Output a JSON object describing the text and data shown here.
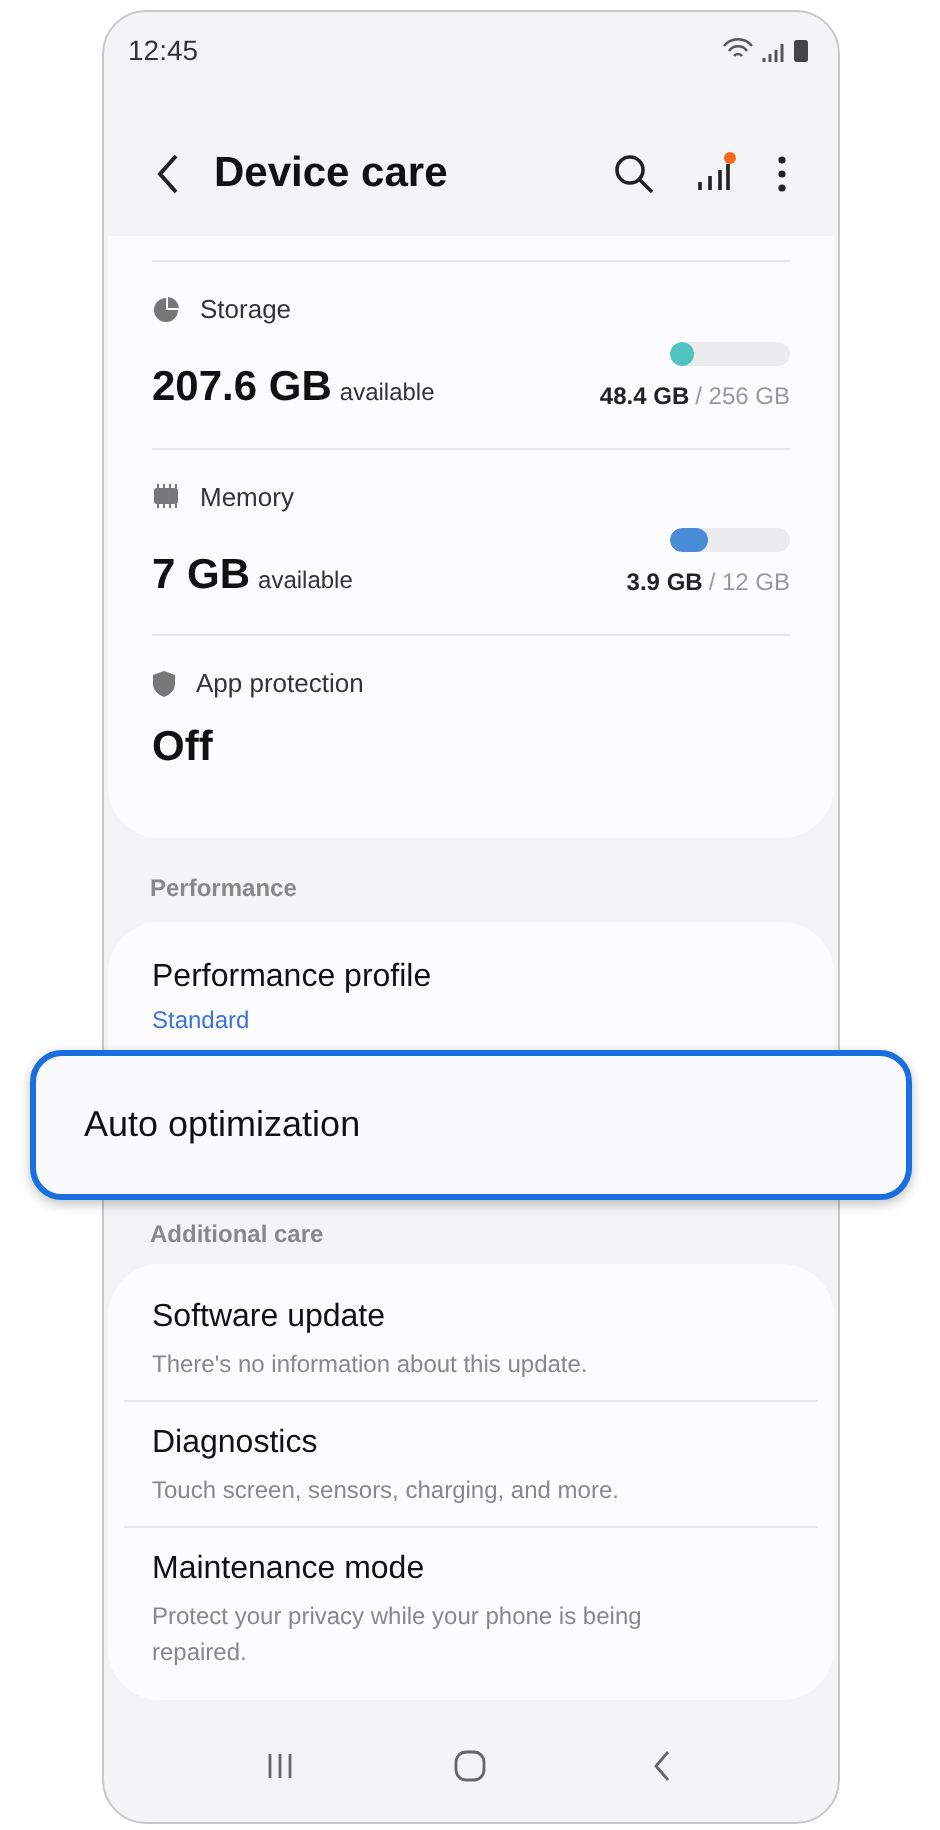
{
  "status_bar": {
    "time": "12:45"
  },
  "header": {
    "title": "Device care",
    "notification_dot": true
  },
  "resources": [
    {
      "kind": "storage",
      "label": "Storage",
      "value": "207.6 GB",
      "unit": "available",
      "level": 0.19,
      "color": "#4fc3c0",
      "used": "48.4 GB",
      "total": "/ 256 GB"
    },
    {
      "kind": "memory",
      "label": "Memory",
      "value": "7 GB",
      "unit": "available",
      "level": 0.32,
      "color": "#4a8bd8",
      "used": "3.9 GB",
      "total": "/ 12 GB"
    },
    {
      "kind": "protection",
      "label": "App protection",
      "value": "Off"
    }
  ],
  "performance": {
    "heading": "Performance",
    "profile": {
      "title": "Performance profile",
      "value": "Standard"
    },
    "highlighted": {
      "title": "Auto optimization"
    }
  },
  "additional_care": {
    "heading": "Additional care",
    "items": [
      {
        "title": "Software update",
        "subtitle": "There's no information about this update."
      },
      {
        "title": "Diagnostics",
        "subtitle": "Touch screen, sensors, charging, and more."
      },
      {
        "title": "Maintenance mode",
        "subtitle": "Protect your privacy while your phone is being repaired."
      }
    ]
  }
}
